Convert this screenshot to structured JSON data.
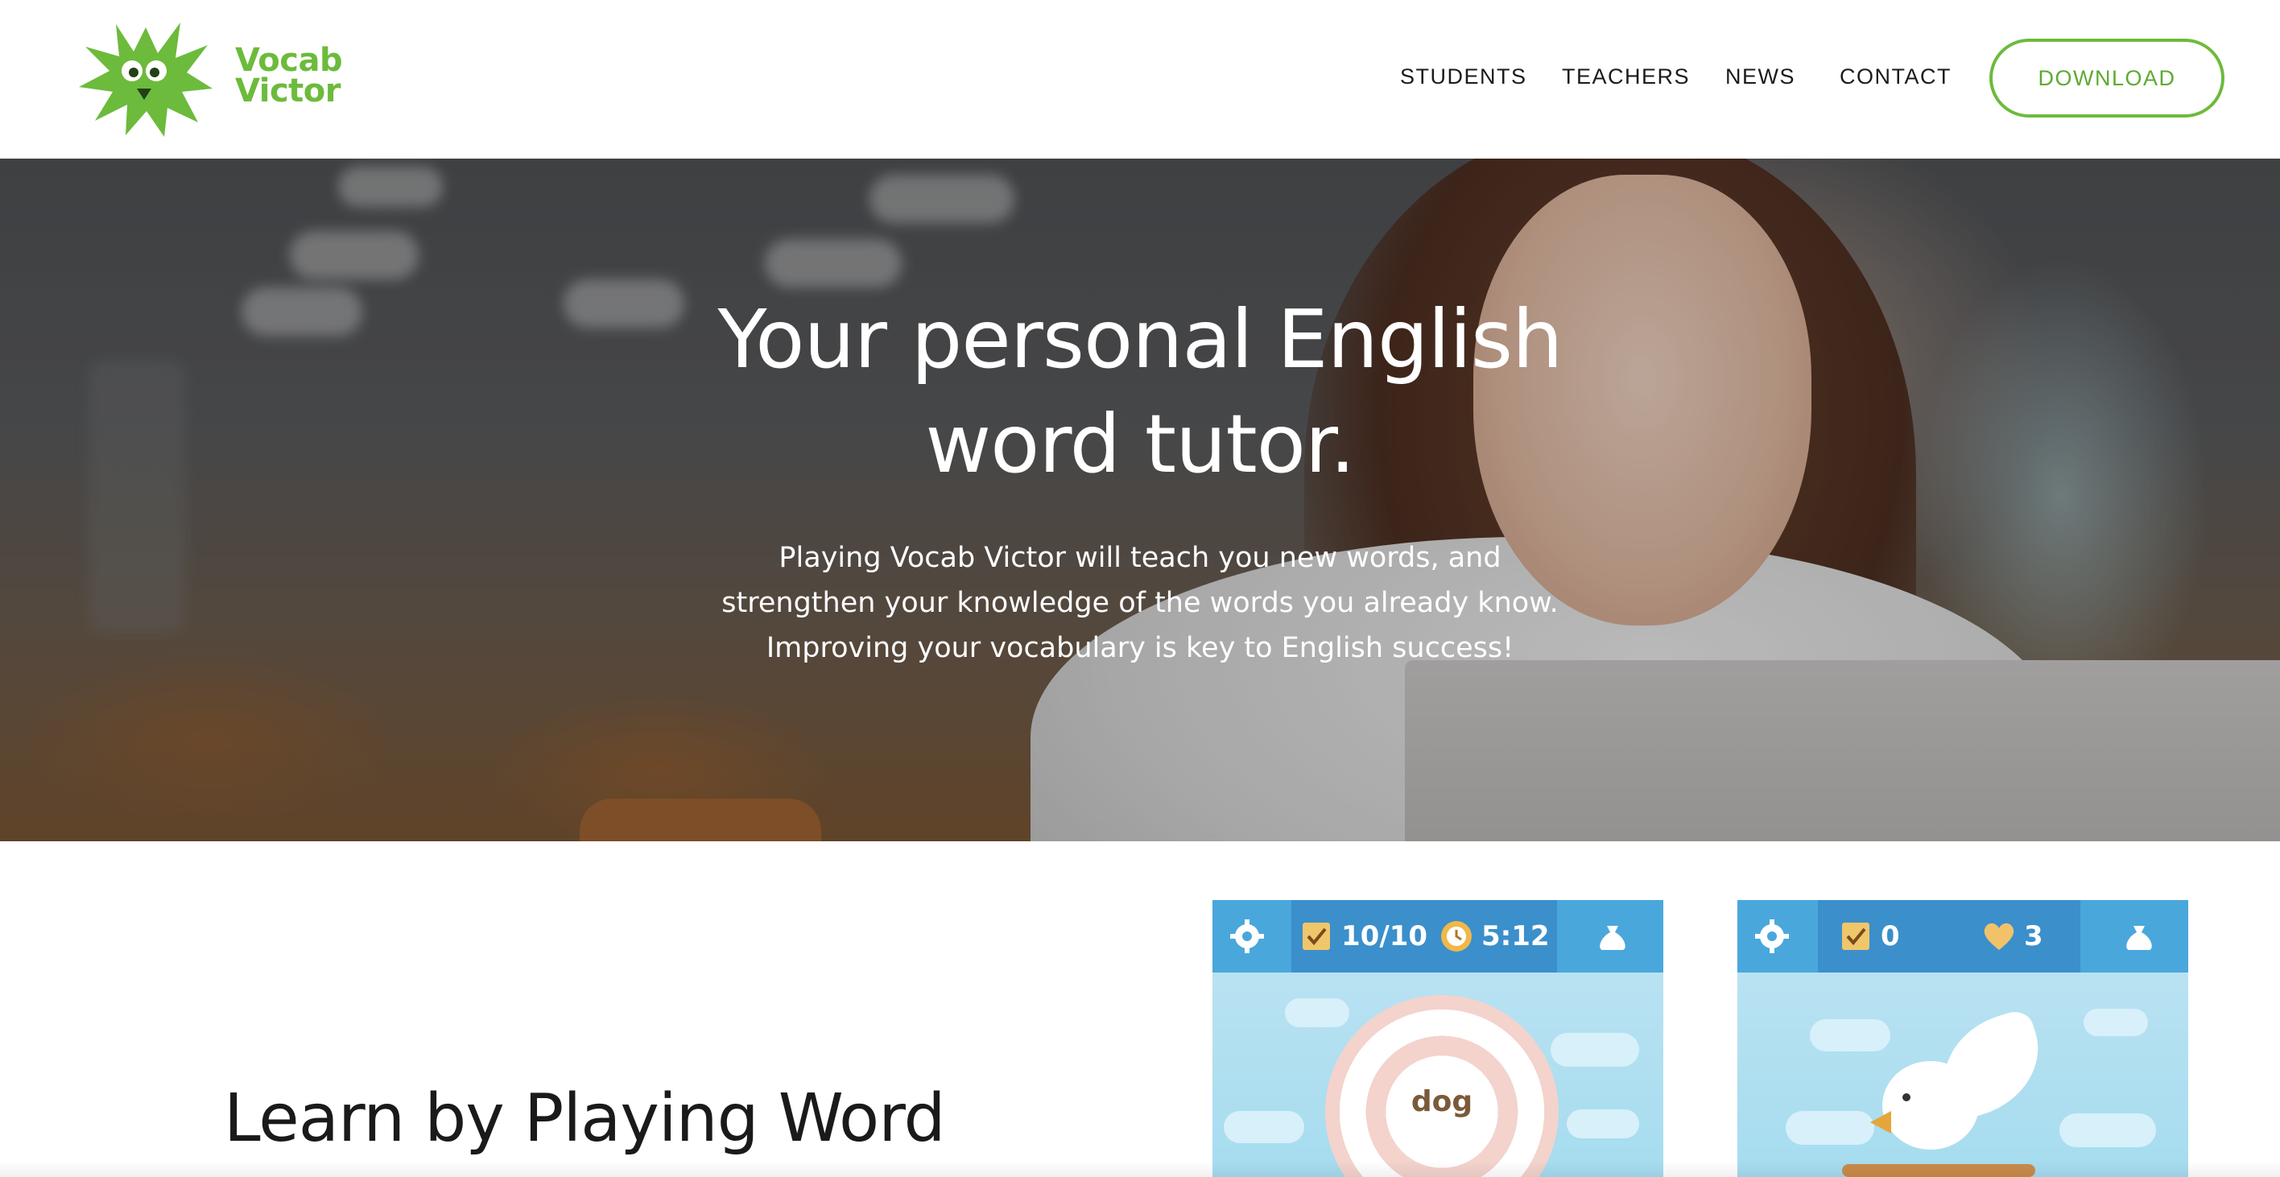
{
  "brand": {
    "name_line1": "Vocab",
    "name_line2": "Victor",
    "color": "#6cbb3c"
  },
  "nav": {
    "items": [
      "STUDENTS",
      "TEACHERS",
      "NEWS",
      "CONTACT"
    ],
    "download_label": "DOWNLOAD"
  },
  "hero": {
    "title_line1": "Your personal English",
    "title_line2": "word tutor.",
    "subtitle_line1": "Playing Vocab Victor will teach you new words, and",
    "subtitle_line2": "strengthen your knowledge of the words you already know.",
    "subtitle_line3": "Improving your vocabulary is key to English success!"
  },
  "section": {
    "title": "Learn by Playing Word"
  },
  "game_cards": [
    {
      "score": "10/10",
      "timer": "5:12",
      "word": "dog",
      "icons": [
        "gear-icon",
        "flag-check-icon",
        "clock-icon",
        "bag-icon"
      ]
    },
    {
      "score": "0",
      "lives": "3",
      "icons": [
        "gear-icon",
        "flag-check-icon",
        "heart-icon",
        "bag-icon"
      ]
    }
  ],
  "colors": {
    "accent_green": "#6cbb3c",
    "game_bar_blue": "#4aa7dc",
    "game_sky": "#a6dcef"
  }
}
